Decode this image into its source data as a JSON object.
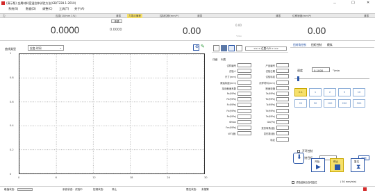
{
  "window": {
    "title": "(演示版) 金属材料室温拉伸试验方法(GB/T228.1-2010)",
    "min": "—",
    "max": "□",
    "close": "✕"
  },
  "menu": [
    "系统(S)",
    "数据(D)",
    "调整(C)",
    "工具(T)",
    "关于(A)"
  ],
  "subbar": {
    "seg1": "力",
    "seg2": "应变(10/mm 1%)",
    "clear1": "清零",
    "tag": "力零点偏差",
    "clear2": "清零",
    "seg3": "控制位移(mm/*)",
    "clear3": "清零",
    "seg4": "位移速度(mm/*)",
    "clear4": "清零",
    "zero": "传感"
  },
  "values": {
    "force": "0.0000",
    "peak": "0.0000",
    "strain": "0.00",
    "disp_small": "0.00",
    "disp_sub": "*/min",
    "speed": "0.00"
  },
  "curve": {
    "label": "曲线类型",
    "selected": "应变-时间"
  },
  "chart_data": {
    "type": "line",
    "x_ticks": [
      "0",
      "6",
      "12",
      "18",
      "24",
      "30"
    ],
    "y_ticks": [
      "1",
      "0.8",
      "0.6",
      "0.4",
      "0.2",
      "0"
    ],
    "xlim": [
      0,
      30
    ],
    "ylim": [
      0,
      1
    ],
    "grid": true,
    "series": []
  },
  "params_panel": {
    "tabs": [
      "详细",
      "列表"
    ],
    "left_labels": [
      "试样编号",
      "试验人",
      "尺寸(mm)",
      "原始标距(mm)",
      "拟设截面系数",
      "Fa(MPa)",
      "Fb(MPa)",
      "Fc(MPa)",
      "Fd(MPa)",
      "Fe(MPa)",
      "Φmax",
      "Fm(MPa)",
      "WT(度)"
    ],
    "right_labels": [
      "产品编号",
      "试验日期",
      "试验标准",
      "试样材料(mm)",
      "断面收缩",
      "Ta(MPa)",
      "Tb(MPa)",
      "Tc(MPa)",
      "Td(MPa)",
      "Te(MPa)",
      "Gd(Pa)",
      "变形转角(度)",
      "变形数(度)",
      "标定"
    ],
    "top_labels": [
      "试样编号",
      "产品名称",
      "试验人"
    ]
  },
  "control": {
    "tabs": [
      "扭转角控制",
      "扭矩控制",
      "模拟"
    ],
    "speed_label": "速度",
    "speed_value": "0.1000",
    "speed_unit": "°/min",
    "preset_row1": [
      "0.1",
      "1",
      "2",
      "5",
      "10"
    ],
    "preset_row2": [
      "20",
      "50",
      "100",
      "200",
      "500"
    ],
    "check1": "开环控制",
    "check2": "保持目标",
    "target_value": "50",
    "apply": "应用",
    "start": "开始",
    "stop": "停止",
    "return": "复位",
    "bottom_check": "试验结束后自动复位",
    "bottom_speed": "( 50 mm/min)"
  },
  "status": {
    "left": "峰值状态:",
    "sys": "系统状态:",
    "sys_val": "试验中",
    "ctrl": "控制状态:",
    "ctrl_val": "停止",
    "sensor": "限位状态:",
    "sensor_val": "未报警"
  },
  "colors": {
    "accent": "#f6e06a",
    "blue": "#2a56a8",
    "red": "#d32a2a"
  }
}
